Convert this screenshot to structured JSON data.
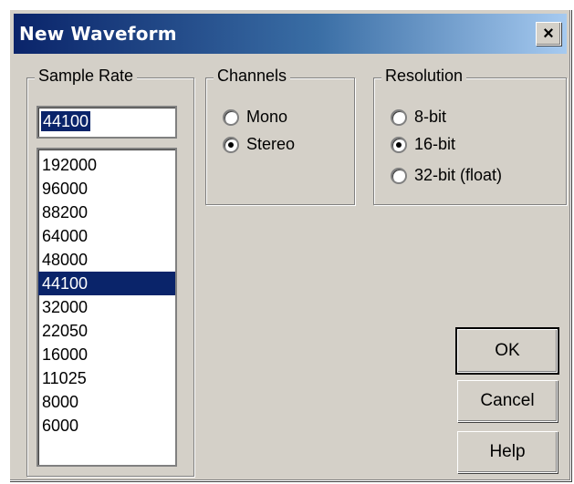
{
  "window": {
    "title": "New Waveform",
    "close_label": "×"
  },
  "sample_rate": {
    "legend": "Sample Rate",
    "value": "44100",
    "options": [
      "192000",
      "96000",
      "88200",
      "64000",
      "48000",
      "44100",
      "32000",
      "22050",
      "16000",
      "11025",
      "8000",
      "6000"
    ],
    "selected": "44100"
  },
  "channels": {
    "legend": "Channels",
    "options": [
      {
        "label": "Mono",
        "selected": false
      },
      {
        "label": "Stereo",
        "selected": true
      }
    ]
  },
  "resolution": {
    "legend": "Resolution",
    "options": [
      {
        "label": "8-bit",
        "selected": false
      },
      {
        "label": "16-bit",
        "selected": true
      },
      {
        "label": "32-bit (float)",
        "selected": false
      }
    ]
  },
  "buttons": {
    "ok": "OK",
    "cancel": "Cancel",
    "help": "Help"
  }
}
